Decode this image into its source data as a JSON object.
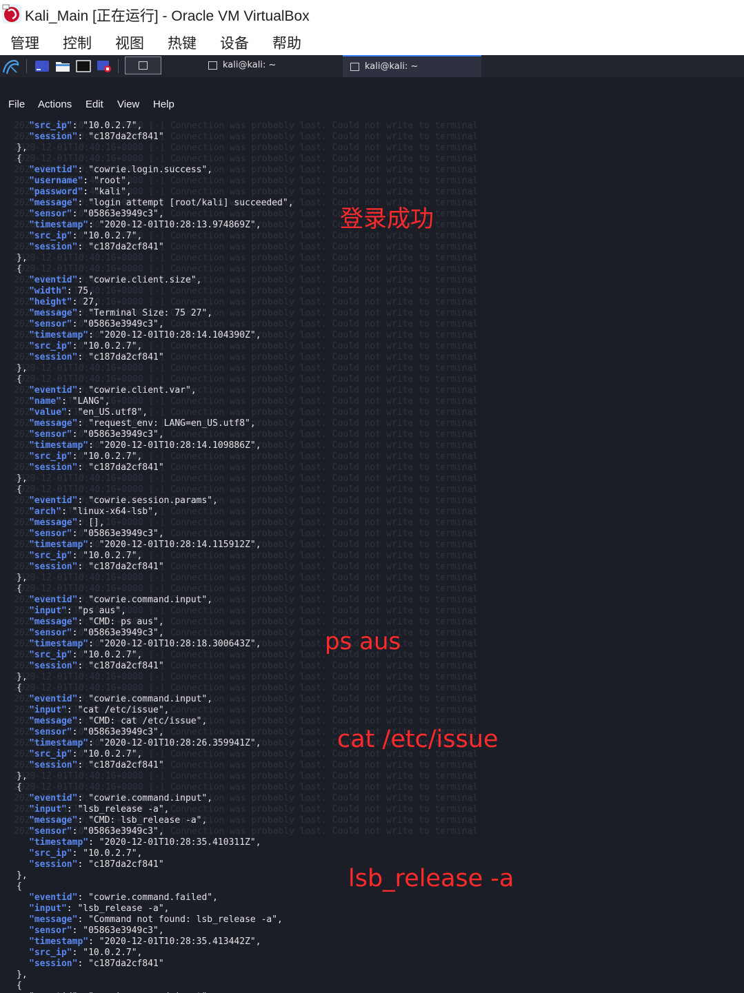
{
  "window": {
    "title": "Kali_Main [正在运行] - Oracle VM VirtualBox",
    "menu": [
      "管理",
      "控制",
      "视图",
      "热键",
      "设备",
      "帮助"
    ]
  },
  "taskbar": {
    "tasks": [
      {
        "label": "kali@kali: ~",
        "active": false
      },
      {
        "label": "kali@kali: ~",
        "active": true
      }
    ]
  },
  "terminal": {
    "menu": [
      "File",
      "Actions",
      "Edit",
      "View",
      "Help"
    ],
    "colors": {
      "background": "#1b1d27",
      "key": "#5b8af2",
      "annotation": "#ff2a2a"
    },
    "ghost_text": "2020-12-01T10:40:16+0000 [-] Connection was probably lost. Could not write to terminal",
    "leading_lines": [
      [
        {
          "k": "src_ip",
          "v": "\"10.0.2.7\","
        }
      ],
      [
        {
          "k": "session",
          "v": "\"c187da2cf841\""
        }
      ]
    ],
    "events": [
      [
        {
          "k": "eventid",
          "v": "\"cowrie.login.success\","
        },
        {
          "k": "username",
          "v": "\"root\","
        },
        {
          "k": "password",
          "v": "\"kali\","
        },
        {
          "k": "message",
          "v": "\"login attempt [root/kali] succeeded\","
        },
        {
          "k": "sensor",
          "v": "\"05863e3949c3\","
        },
        {
          "k": "timestamp",
          "v": "\"2020-12-01T10:28:13.974869Z\","
        },
        {
          "k": "src_ip",
          "v": "\"10.0.2.7\","
        },
        {
          "k": "session",
          "v": "\"c187da2cf841\""
        }
      ],
      [
        {
          "k": "eventid",
          "v": "\"cowrie.client.size\","
        },
        {
          "k": "width",
          "v": "75,"
        },
        {
          "k": "height",
          "v": "27,"
        },
        {
          "k": "message",
          "v": "\"Terminal Size: 75 27\","
        },
        {
          "k": "sensor",
          "v": "\"05863e3949c3\","
        },
        {
          "k": "timestamp",
          "v": "\"2020-12-01T10:28:14.104390Z\","
        },
        {
          "k": "src_ip",
          "v": "\"10.0.2.7\","
        },
        {
          "k": "session",
          "v": "\"c187da2cf841\""
        }
      ],
      [
        {
          "k": "eventid",
          "v": "\"cowrie.client.var\","
        },
        {
          "k": "name",
          "v": "\"LANG\","
        },
        {
          "k": "value",
          "v": "\"en_US.utf8\","
        },
        {
          "k": "message",
          "v": "\"request_env: LANG=en_US.utf8\","
        },
        {
          "k": "sensor",
          "v": "\"05863e3949c3\","
        },
        {
          "k": "timestamp",
          "v": "\"2020-12-01T10:28:14.109886Z\","
        },
        {
          "k": "src_ip",
          "v": "\"10.0.2.7\","
        },
        {
          "k": "session",
          "v": "\"c187da2cf841\""
        }
      ],
      [
        {
          "k": "eventid",
          "v": "\"cowrie.session.params\","
        },
        {
          "k": "arch",
          "v": "\"linux-x64-lsb\","
        },
        {
          "k": "message",
          "v": "[],"
        },
        {
          "k": "sensor",
          "v": "\"05863e3949c3\","
        },
        {
          "k": "timestamp",
          "v": "\"2020-12-01T10:28:14.115912Z\","
        },
        {
          "k": "src_ip",
          "v": "\"10.0.2.7\","
        },
        {
          "k": "session",
          "v": "\"c187da2cf841\""
        }
      ],
      [
        {
          "k": "eventid",
          "v": "\"cowrie.command.input\","
        },
        {
          "k": "input",
          "v": "\"ps aus\","
        },
        {
          "k": "message",
          "v": "\"CMD: ps aus\","
        },
        {
          "k": "sensor",
          "v": "\"05863e3949c3\","
        },
        {
          "k": "timestamp",
          "v": "\"2020-12-01T10:28:18.300643Z\","
        },
        {
          "k": "src_ip",
          "v": "\"10.0.2.7\","
        },
        {
          "k": "session",
          "v": "\"c187da2cf841\""
        }
      ],
      [
        {
          "k": "eventid",
          "v": "\"cowrie.command.input\","
        },
        {
          "k": "input",
          "v": "\"cat /etc/issue\","
        },
        {
          "k": "message",
          "v": "\"CMD: cat /etc/issue\","
        },
        {
          "k": "sensor",
          "v": "\"05863e3949c3\","
        },
        {
          "k": "timestamp",
          "v": "\"2020-12-01T10:28:26.359941Z\","
        },
        {
          "k": "src_ip",
          "v": "\"10.0.2.7\","
        },
        {
          "k": "session",
          "v": "\"c187da2cf841\""
        }
      ],
      [
        {
          "k": "eventid",
          "v": "\"cowrie.command.input\","
        },
        {
          "k": "input",
          "v": "\"lsb_release -a\","
        },
        {
          "k": "message",
          "v": "\"CMD: lsb_release -a\","
        },
        {
          "k": "sensor",
          "v": "\"05863e3949c3\","
        },
        {
          "k": "timestamp",
          "v": "\"2020-12-01T10:28:35.410311Z\","
        },
        {
          "k": "src_ip",
          "v": "\"10.0.2.7\","
        },
        {
          "k": "session",
          "v": "\"c187da2cf841\""
        }
      ],
      [
        {
          "k": "eventid",
          "v": "\"cowrie.command.failed\","
        },
        {
          "k": "input",
          "v": "\"lsb_release -a\","
        },
        {
          "k": "message",
          "v": "\"Command not found: lsb_release -a\","
        },
        {
          "k": "sensor",
          "v": "\"05863e3949c3\","
        },
        {
          "k": "timestamp",
          "v": "\"2020-12-01T10:28:35.413442Z\","
        },
        {
          "k": "src_ip",
          "v": "\"10.0.2.7\","
        },
        {
          "k": "session",
          "v": "\"c187da2cf841\""
        }
      ]
    ],
    "trailing_partial": "\"eventid\": \"cowrie.command.input\","
  },
  "annotations": [
    "登录成功",
    "ps aus",
    "cat /etc/issue",
    "lsb_release -a"
  ]
}
